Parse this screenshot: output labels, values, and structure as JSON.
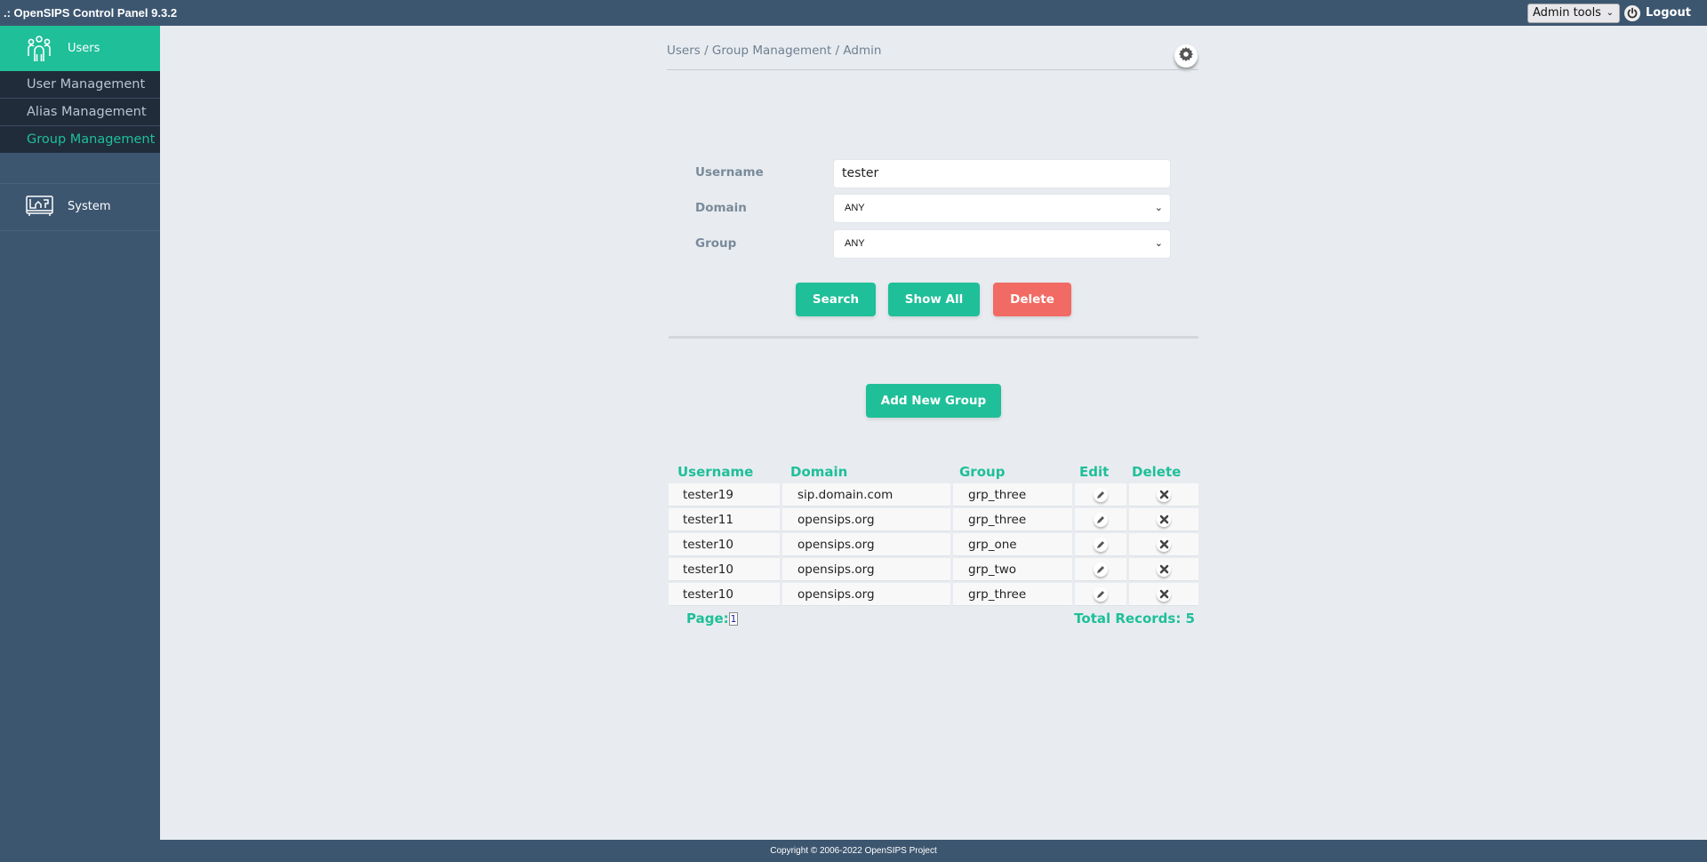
{
  "header": {
    "app_title": ".: OpenSIPS Control Panel 9.3.2",
    "admin_tools": "Admin tools",
    "logout": "Logout"
  },
  "sidebar": {
    "users": "Users",
    "items": [
      {
        "label": "User Management"
      },
      {
        "label": "Alias Management"
      },
      {
        "label": "Group Management",
        "active": true
      }
    ],
    "system": "System"
  },
  "breadcrumb": "Users / Group Management / Admin",
  "form": {
    "username_label": "Username",
    "username_value": "tester",
    "domain_label": "Domain",
    "domain_value": "ANY",
    "group_label": "Group",
    "group_value": "ANY"
  },
  "buttons": {
    "search": "Search",
    "show_all": "Show All",
    "delete": "Delete",
    "add_new_group": "Add New Group"
  },
  "table": {
    "headers": [
      "Username",
      "Domain",
      "Group",
      "Edit",
      "Delete"
    ],
    "rows": [
      {
        "username": "tester19",
        "domain": "sip.domain.com",
        "group": "grp_three"
      },
      {
        "username": "tester11",
        "domain": "opensips.org",
        "group": "grp_three"
      },
      {
        "username": "tester10",
        "domain": "opensips.org",
        "group": "grp_one"
      },
      {
        "username": "tester10",
        "domain": "opensips.org",
        "group": "grp_two"
      },
      {
        "username": "tester10",
        "domain": "opensips.org",
        "group": "grp_three"
      }
    ]
  },
  "pagination": {
    "page_label": "Page:",
    "current_page": "1",
    "total_records": "Total Records: 5"
  },
  "footer": "Copyright © 2006-2022 OpenSIPS Project",
  "colors": {
    "accent": "#1fbf99",
    "danger": "#f16a63",
    "navbar": "#3d5670"
  }
}
